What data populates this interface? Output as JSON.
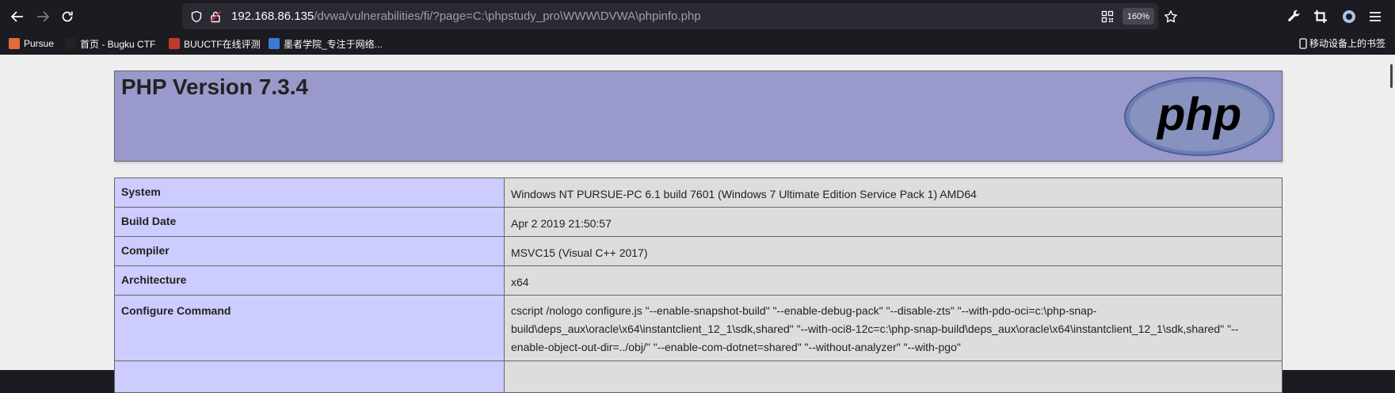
{
  "browser": {
    "url_host": "192.168.86.135",
    "url_path": "/dvwa/vulnerabilities/fi/?page=C:\\phpstudy_pro\\WWW\\DVWA\\phpinfo.php",
    "zoom": "160%"
  },
  "bookmarks": {
    "items": [
      {
        "label": "Pursue",
        "color": "#e06c3a"
      },
      {
        "label": "首页 - Bugku CTF",
        "color": "#222222"
      },
      {
        "label": "BUUCTF在线评测",
        "color": "#c0392b"
      },
      {
        "label": "墨者学院_专注于网络...",
        "color": "#3a7bd5"
      }
    ],
    "mobile": "移动设备上的书签"
  },
  "phpinfo": {
    "title": "PHP Version 7.3.4",
    "logo_text": "php",
    "rows": [
      {
        "key": "System",
        "value": "Windows NT PURSUE-PC 6.1 build 7601 (Windows 7 Ultimate Edition Service Pack 1) AMD64"
      },
      {
        "key": "Build Date",
        "value": "Apr 2 2019 21:50:57"
      },
      {
        "key": "Compiler",
        "value": "MSVC15 (Visual C++ 2017)"
      },
      {
        "key": "Architecture",
        "value": "x64"
      },
      {
        "key": "Configure Command",
        "value": "cscript /nologo configure.js \"--enable-snapshot-build\" \"--enable-debug-pack\" \"--disable-zts\" \"--with-pdo-oci=c:\\php-snap-build\\deps_aux\\oracle\\x64\\instantclient_12_1\\sdk,shared\" \"--with-oci8-12c=c:\\php-snap-build\\deps_aux\\oracle\\x64\\instantclient_12_1\\sdk,shared\" \"--enable-object-out-dir=../obj/\" \"--enable-com-dotnet=shared\" \"--without-analyzer\" \"--with-pgo\""
      }
    ]
  }
}
